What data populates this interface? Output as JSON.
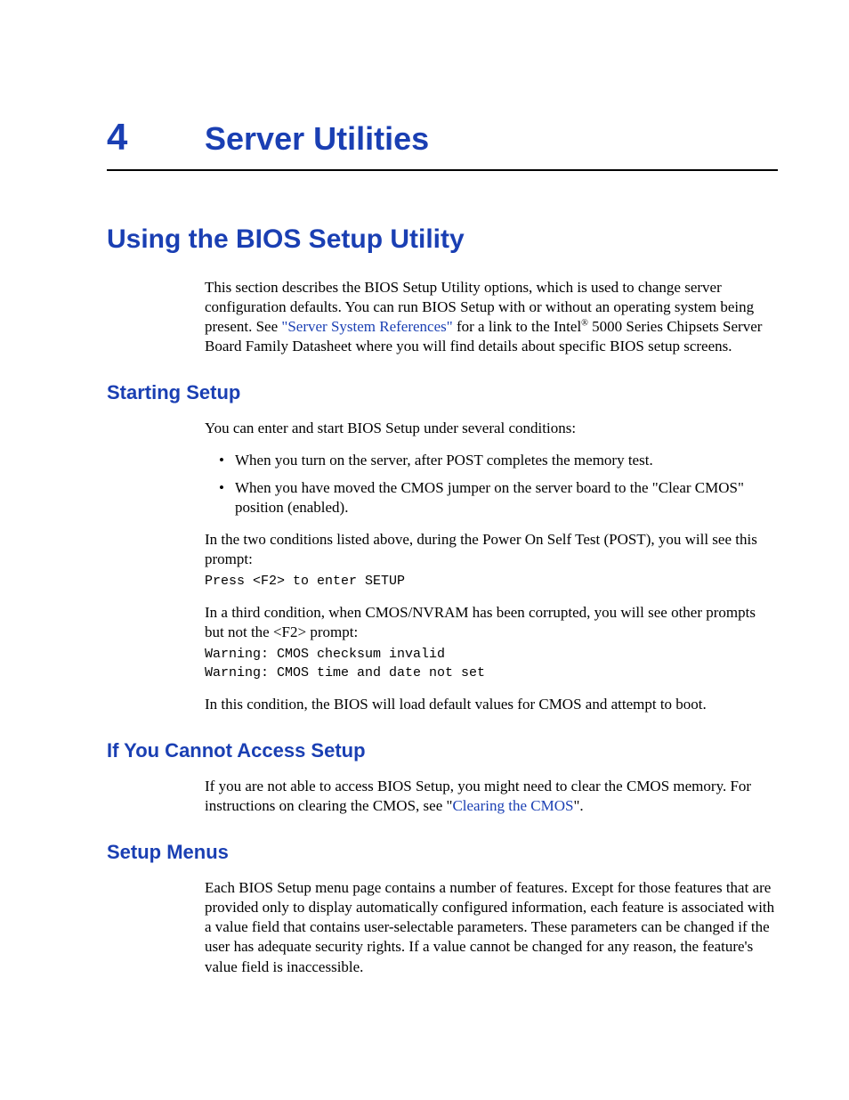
{
  "chapter": {
    "number": "4",
    "title": "Server Utilities"
  },
  "section": {
    "heading": "Using the BIOS Setup Utility",
    "intro_pre": "This section describes the BIOS Setup Utility options, which is used to change server configuration defaults. You can run BIOS Setup with or without an operating system being present. See ",
    "intro_link": "\"Server System References\"",
    "intro_mid": " for a link to the Intel",
    "intro_reg": "®",
    "intro_post": " 5000 Series Chipsets Server Board Family Datasheet where you will find details about specific BIOS setup screens."
  },
  "starting": {
    "heading": "Starting Setup",
    "p1": "You can enter and start BIOS Setup under several conditions:",
    "bullets": [
      "When you turn on the server, after POST completes the memory test.",
      "When you have moved the CMOS jumper on the server board to the \"Clear CMOS\" position (enabled)."
    ],
    "p2": "In the two conditions listed above, during the Power On Self Test (POST), you will see this prompt:",
    "code1": "Press <F2> to enter SETUP",
    "p3": "In a third condition, when CMOS/NVRAM has been corrupted, you will see other prompts but not the <F2> prompt:",
    "code2": "Warning: CMOS checksum invalid\nWarning: CMOS time and date not set",
    "p4": "In this condition, the BIOS will load default values for CMOS and attempt to boot."
  },
  "cannot": {
    "heading": "If You Cannot Access Setup",
    "p_pre": "If you are not able to access BIOS Setup, you might need to clear the CMOS memory. For instructions on clearing the CMOS, see \"",
    "p_link": "Clearing the CMOS",
    "p_post": "\"."
  },
  "menus": {
    "heading": "Setup Menus",
    "p": "Each BIOS Setup menu page contains a number of features. Except for those features that are provided only to display automatically configured information, each feature is associated with a value field that contains user-selectable parameters. These parameters can be changed if the user has adequate security rights. If a value cannot be changed for any reason, the feature's value field is inaccessible."
  }
}
